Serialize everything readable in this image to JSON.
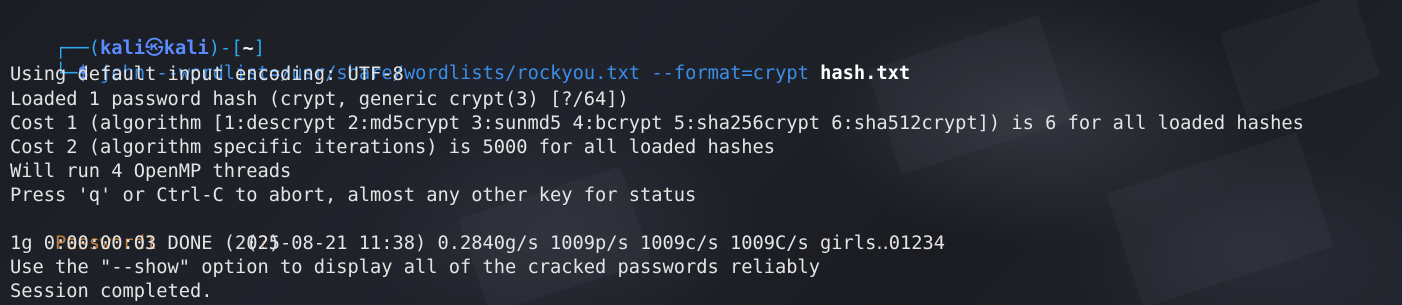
{
  "prompt": {
    "frame_top_left": "┌──(",
    "user": "kali",
    "at_symbol": "㉿",
    "host": "kali",
    "frame_mid": ")-[",
    "dir": "~",
    "frame_end": "]",
    "frame_bottom_left": "└─",
    "dollar": "$"
  },
  "command": {
    "text": "john --wordlist=/usr/share/wordlists/rockyou.txt --format=crypt",
    "file_arg": "hash.txt"
  },
  "output": [
    "Using default input encoding: UTF-8",
    "Loaded 1 password hash (crypt, generic crypt(3) [?/64])",
    "Cost 1 (algorithm [1:descrypt 2:md5crypt 3:sunmd5 4:bcrypt 5:sha256crypt 6:sha512crypt]) is 6 for all loaded hashes",
    "Cost 2 (algorithm specific iterations) is 5000 for all loaded hashes",
    "Will run 4 OpenMP threads",
    "Press 'q' or Ctrl-C to abort, almost any other key for status"
  ],
  "cracked": {
    "password": "Password1",
    "spacer": "        ",
    "tag_open": "(",
    "tag_q": "?",
    "tag_close": ")"
  },
  "summary": [
    "1g 0:00:00:03 DONE (2025-08-21 11:38) 0.2840g/s 1009p/s 1009c/s 1009C/s girls‥01234",
    "Use the \"--show\" option to display all of the cracked passwords reliably",
    "Session completed."
  ],
  "colors": {
    "background": "#1d1f26",
    "prompt_blue": "#2fa6ea",
    "user_blue": "#5b8cff",
    "command_blue": "#3b8ee8",
    "password_orange": "#c2803a",
    "text": "#e4e4e4"
  }
}
